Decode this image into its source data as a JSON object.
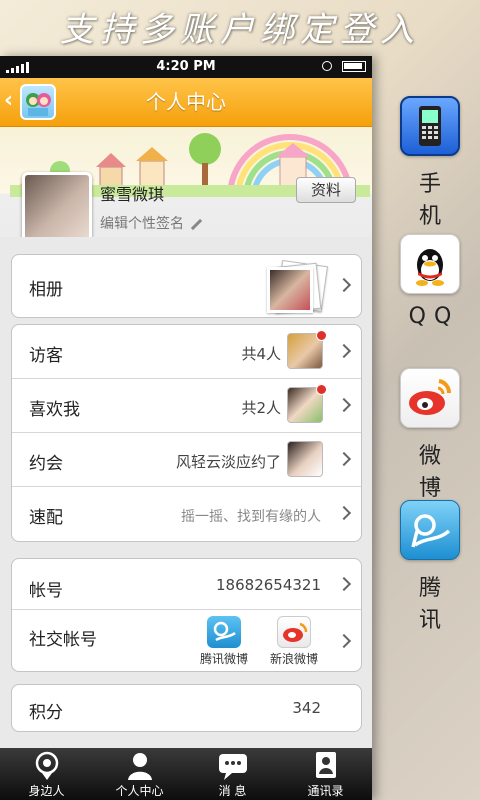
{
  "banner": {
    "text": "支持多账户绑定登入"
  },
  "status": {
    "time": "4:20 PM"
  },
  "nav": {
    "title": "个人中心"
  },
  "profile": {
    "name": "蜜雪微琪",
    "edit_button": "资料",
    "signature_placeholder": "编辑个性签名"
  },
  "groups": {
    "album": {
      "label": "相册"
    },
    "visitors": {
      "label": "访客",
      "value": "共4人"
    },
    "likes": {
      "label": "喜欢我",
      "value": "共2人"
    },
    "dates": {
      "label": "约会",
      "value": "风轻云淡应约了"
    },
    "match": {
      "label": "速配",
      "value": "摇一摇、找到有缘的人"
    },
    "account": {
      "label": "帐号",
      "value": "18682654321"
    },
    "social_accounts": {
      "label": "社交帐号",
      "tencent": "腾讯微博",
      "sina": "新浪微博"
    },
    "points": {
      "label": "积分",
      "value": "342"
    }
  },
  "tabbar": [
    "身边人",
    "个人中心",
    "消 息",
    "通讯录"
  ],
  "side": {
    "phone": "手机",
    "qq": "QQ",
    "weibo": "微博",
    "tencent": "腾讯"
  },
  "colors": {
    "accent": "#f5a00b",
    "red_dot": "#e0302a"
  }
}
